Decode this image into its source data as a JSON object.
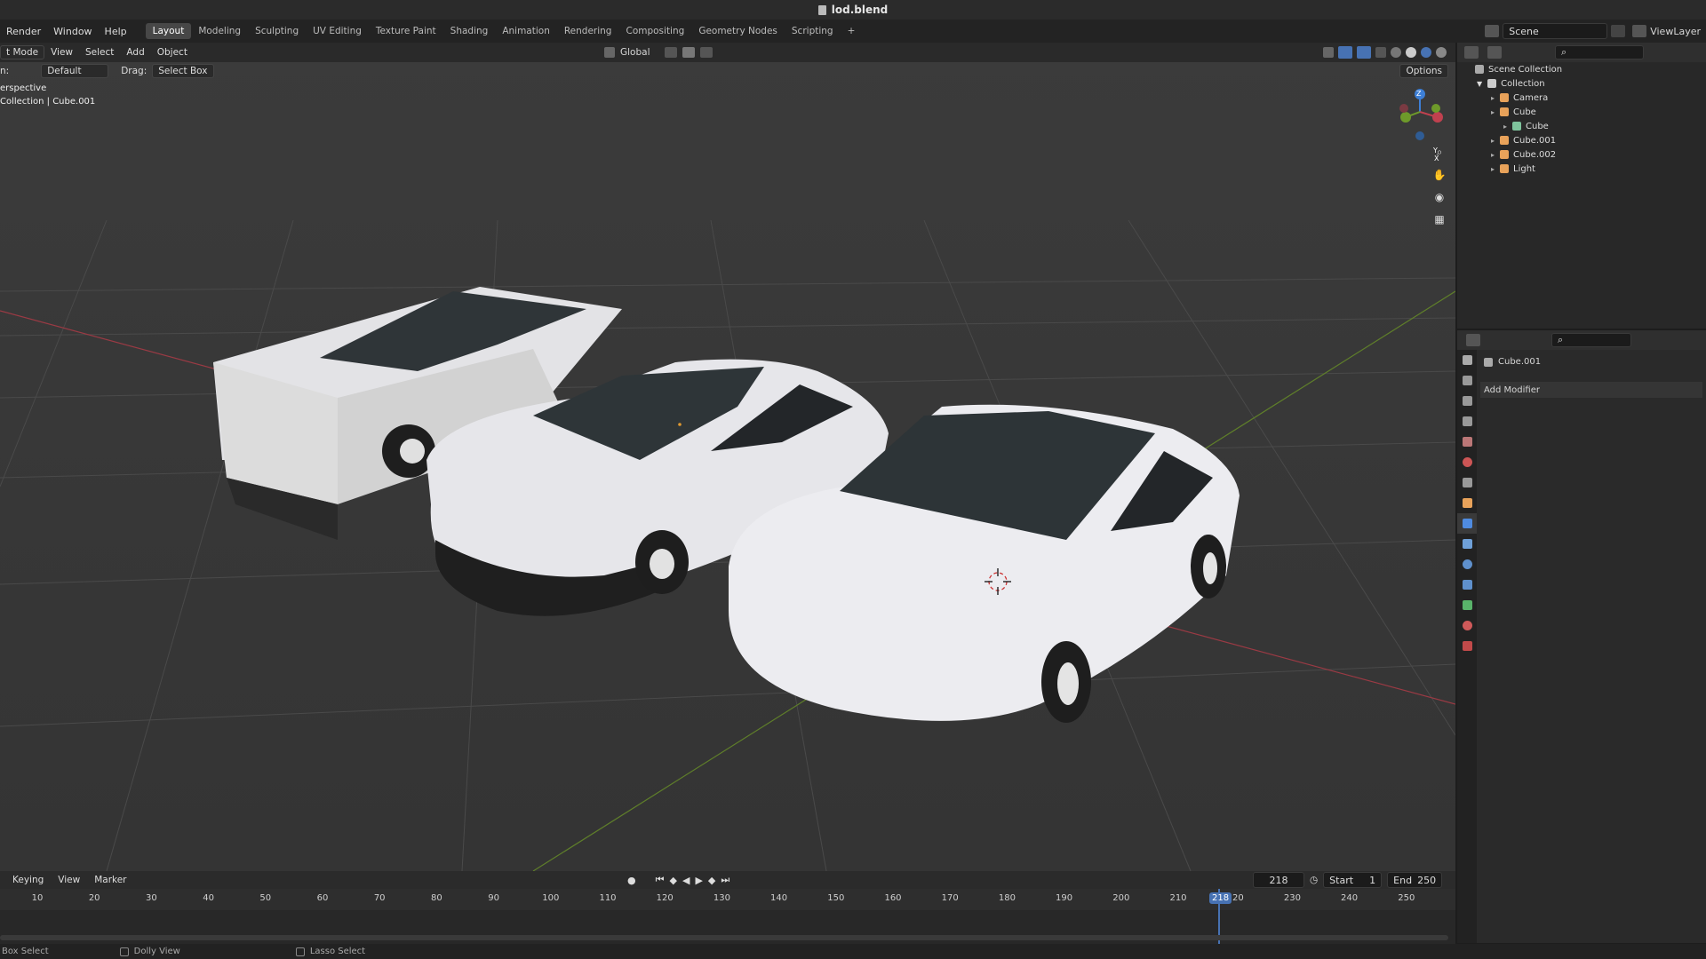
{
  "window_title": "lod.blend",
  "menu": [
    "Render",
    "Window",
    "Help"
  ],
  "workspaces": [
    "Layout",
    "Modeling",
    "Sculpting",
    "UV Editing",
    "Texture Paint",
    "Shading",
    "Animation",
    "Rendering",
    "Compositing",
    "Geometry Nodes",
    "Scripting"
  ],
  "add_workspace": "+",
  "scene": {
    "label": "Scene",
    "viewlayer": "ViewLayer"
  },
  "viewport": {
    "mode": "t Mode",
    "menus": [
      "View",
      "Select",
      "Add",
      "Object"
    ],
    "orientation": "Global",
    "orientation_prefix": "n:",
    "orientation_value": "Default",
    "drag_label": "Drag:",
    "drag_value": "Select Box",
    "options": "Options",
    "info_line1": "erspective",
    "info_line2": "Collection | Cube.001",
    "gizmo": {
      "z": "Z",
      "y": "Y",
      "x": "X"
    }
  },
  "outliner": {
    "root": "Scene Collection",
    "collection": "Collection",
    "items": [
      {
        "name": "Camera",
        "color": "#e8a25a",
        "level": 2
      },
      {
        "name": "Cube",
        "color": "#e8a25a",
        "level": 2
      },
      {
        "name": "Cube",
        "color": "#7ec39c",
        "level": 3
      },
      {
        "name": "Cube.001",
        "color": "#e8a25a",
        "level": 2
      },
      {
        "name": "Cube.002",
        "color": "#e8a25a",
        "level": 2
      },
      {
        "name": "Light",
        "color": "#e8a25a",
        "level": 2
      }
    ]
  },
  "properties": {
    "object_name": "Cube.001",
    "add_modifier": "Add Modifier"
  },
  "timeline": {
    "menus": [
      "Keying",
      "View",
      "Marker"
    ],
    "current_frame": "218",
    "start_label": "Start",
    "start": "1",
    "end_label": "End",
    "end": "250",
    "ticks": [
      "10",
      "20",
      "30",
      "40",
      "50",
      "60",
      "70",
      "80",
      "90",
      "100",
      "110",
      "120",
      "130",
      "140",
      "150",
      "160",
      "170",
      "180",
      "190",
      "200",
      "210",
      "220",
      "230",
      "240",
      "250"
    ],
    "playhead_label": "218"
  },
  "status": [
    "Box Select",
    "Dolly View",
    "Lasso Select"
  ],
  "colors": {
    "accent": "#4772b3",
    "x_axis": "#c0414f",
    "y_axis": "#6e9a2a",
    "z_axis": "#3d7fd6"
  }
}
